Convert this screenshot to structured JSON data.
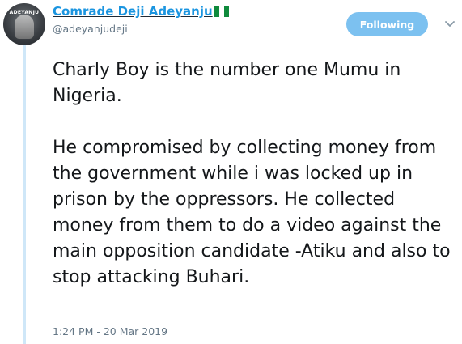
{
  "author": {
    "display_name": "Comrade Deji Adeyanju",
    "handle": "@adeyanjudeji",
    "avatar_caption": "ADEYANJU",
    "flag_icon": "nigeria-flag-icon"
  },
  "actions": {
    "follow_label": "Following",
    "caret_icon": "chevron-down-icon"
  },
  "tweet": {
    "paragraphs": [
      "Charly Boy is the number one Mumu in Nigeria.",
      "He compromised by collecting money from the government while i was locked up in prison by the oppressors. He collected money from them to do a video against the main opposition candidate -Atiku and also to stop attacking Buhari."
    ],
    "timestamp": "1:24 PM - 20 Mar 2019"
  },
  "colors": {
    "follow_button_bg": "#7cc1f0",
    "name_link": "#1b95e0",
    "secondary_text": "#657786",
    "thread_line": "#cfe7f8",
    "flag_green": "#0f8a3c"
  }
}
